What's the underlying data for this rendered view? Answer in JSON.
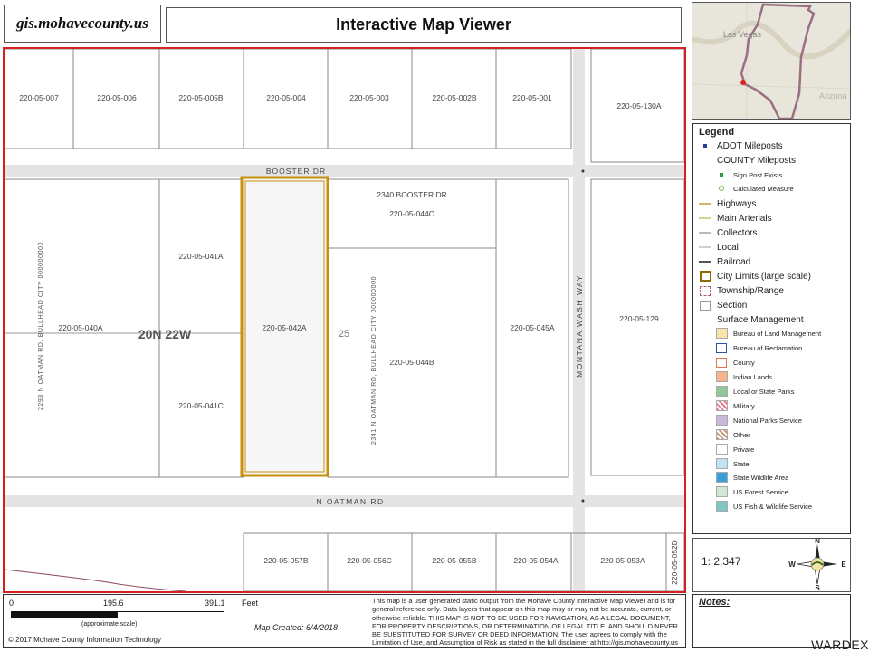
{
  "header": {
    "site_url": "gis.mohavecounty.us",
    "title": "Interactive Map Viewer"
  },
  "inset": {
    "city_label": "Las Vegas",
    "state_label": "Arizona"
  },
  "map": {
    "roads": {
      "booster_dr": "BOOSTER DR",
      "n_oatman_rd": "N OATMAN RD",
      "montana_wash_way": "MONTANA WASH WAY",
      "oatman_2293": "2293 N OATMAN RD, BULLHEAD CITY 000000000",
      "oatman_2341": "2341 N OATMAN RD, BULLHEAD CITY 000000000"
    },
    "township_range": "20N 22W",
    "section_number": "25",
    "address_2340": "2340 BOOSTER DR",
    "parcels": {
      "p007": "220-05-007",
      "p006": "220-05-006",
      "p005b": "220-05-005B",
      "p004": "220-05-004",
      "p003": "220-05-003",
      "p002b": "220-05-002B",
      "p001": "220-05-001",
      "p130a": "220-05-130A",
      "p044c": "220-05-044C",
      "p041a": "220-05-041A",
      "p040a": "220-05-040A",
      "p042a": "220-05-042A",
      "p044b": "220-05-044B",
      "p045a": "220-05-045A",
      "p129": "220-05-129",
      "p041c": "220-05-041C",
      "p057b": "220-05-057B",
      "p056c": "220-05-056C",
      "p055b": "220-05-055B",
      "p054a": "220-05-054A",
      "p053a": "220-05-053A",
      "p052d": "220-05-052D"
    }
  },
  "legend": {
    "title": "Legend",
    "items": [
      {
        "label": "ADOT Mileposts",
        "sym": "dot",
        "color": "#1f3f99",
        "indent": false,
        "small": false
      },
      {
        "label": "COUNTY Mileposts",
        "sym": "none",
        "color": "",
        "indent": false,
        "small": false
      },
      {
        "label": "Sign Post Exists",
        "sym": "dot",
        "color": "#2e9b3a",
        "indent": true,
        "small": true
      },
      {
        "label": "Calculated Measure",
        "sym": "ring",
        "color": "#7ab648",
        "indent": true,
        "small": true
      },
      {
        "label": "Highways",
        "sym": "line",
        "color": "#d4b36c",
        "indent": false,
        "small": false
      },
      {
        "label": "Main Arterials",
        "sym": "line",
        "color": "#cfd78f",
        "indent": false,
        "small": false
      },
      {
        "label": "Collectors",
        "sym": "line",
        "color": "#b9b9b9",
        "indent": false,
        "small": false
      },
      {
        "label": "Local",
        "sym": "line",
        "color": "#cfcfcf",
        "indent": false,
        "small": false
      },
      {
        "label": "Railroad",
        "sym": "line",
        "color": "#555555",
        "indent": false,
        "small": false
      },
      {
        "label": "City Limits (large scale)",
        "sym": "thickbox",
        "color": "#8c6a00",
        "indent": false,
        "small": false
      },
      {
        "label": "Township/Range",
        "sym": "dashbox",
        "color": "#b05a7a",
        "indent": false,
        "small": false
      },
      {
        "label": "Section",
        "sym": "box",
        "color": "#9a9a9a",
        "indent": false,
        "small": false
      },
      {
        "label": "Surface Management",
        "sym": "none",
        "color": "",
        "indent": false,
        "small": false
      },
      {
        "label": "Bureau of Land Management",
        "sym": "fill",
        "color": "#f8e3a8",
        "indent": true,
        "small": true
      },
      {
        "label": "Bureau of Reclamation",
        "sym": "outline",
        "color": "#2b55a5",
        "indent": true,
        "small": true
      },
      {
        "label": "County",
        "sym": "outline",
        "color": "#e0764c",
        "indent": true,
        "small": true
      },
      {
        "label": "Indian Lands",
        "sym": "fill",
        "color": "#f6b58a",
        "indent": true,
        "small": true
      },
      {
        "label": "Local or State Parks",
        "sym": "fill",
        "color": "#8fc99a",
        "indent": true,
        "small": true
      },
      {
        "label": "Military",
        "sym": "hatch",
        "color": "#e77b93",
        "indent": true,
        "small": true
      },
      {
        "label": "National Parks Service",
        "sym": "fill",
        "color": "#c9b7dc",
        "indent": true,
        "small": true
      },
      {
        "label": "Other",
        "sym": "hatch",
        "color": "#c79a73",
        "indent": true,
        "small": true
      },
      {
        "label": "Private",
        "sym": "fill",
        "color": "#ffffff",
        "indent": true,
        "small": true
      },
      {
        "label": "State",
        "sym": "fill",
        "color": "#bfe3f3",
        "indent": true,
        "small": true
      },
      {
        "label": "State Wildlife Area",
        "sym": "fill",
        "color": "#3a9ed8",
        "indent": true,
        "small": true
      },
      {
        "label": "US Forest Service",
        "sym": "fill",
        "color": "#cfe8d3",
        "indent": true,
        "small": true
      },
      {
        "label": "US Fish & Wildlife Service",
        "sym": "fill",
        "color": "#7fc7c0",
        "indent": true,
        "small": true
      }
    ]
  },
  "scale": {
    "ratio": "1: 2,347",
    "tick0": "0",
    "tick1": "195.6",
    "tick2": "391.1",
    "units": "Feet",
    "approx": "(approximate scale)",
    "bar_fraction": 0.5
  },
  "compass": {
    "n": "N",
    "s": "S",
    "e": "E",
    "w": "W"
  },
  "footer": {
    "copyright": "© 2017 Mohave County Information Technology",
    "map_created": "Map Created: 6/4/2018",
    "disclaimer": [
      "This map is a user generated static output from the Mohave County Interactive Map Viewer and is for",
      "general reference only. Data layers that appear on this map may or may not be accurate, current, or",
      "otherwise reliable. THIS MAP IS NOT TO BE USED FOR NAVIGATION, AS A LEGAL DOCUMENT,",
      "FOR PROPERTY DESCRIPTIONS, OR DETERMINATION OF LEGAL TITLE, AND SHOULD NEVER",
      "BE SUBSTITUTED FOR SURVEY OR DEED INFORMATION. The user agrees to comply with the",
      "Limitation of Use, and Assumption of Risk as stated in the full disclaimer at http://gis.mohavecounty.us"
    ],
    "notes_label": "Notes:"
  },
  "watermark": "WARDEX",
  "colors": {
    "frame_red": "#d42020",
    "subject_parcel": "#c8900c",
    "parcel_line": "#8a8a8a",
    "road": "#d9d9d9",
    "township_line": "#8b4a5e"
  }
}
